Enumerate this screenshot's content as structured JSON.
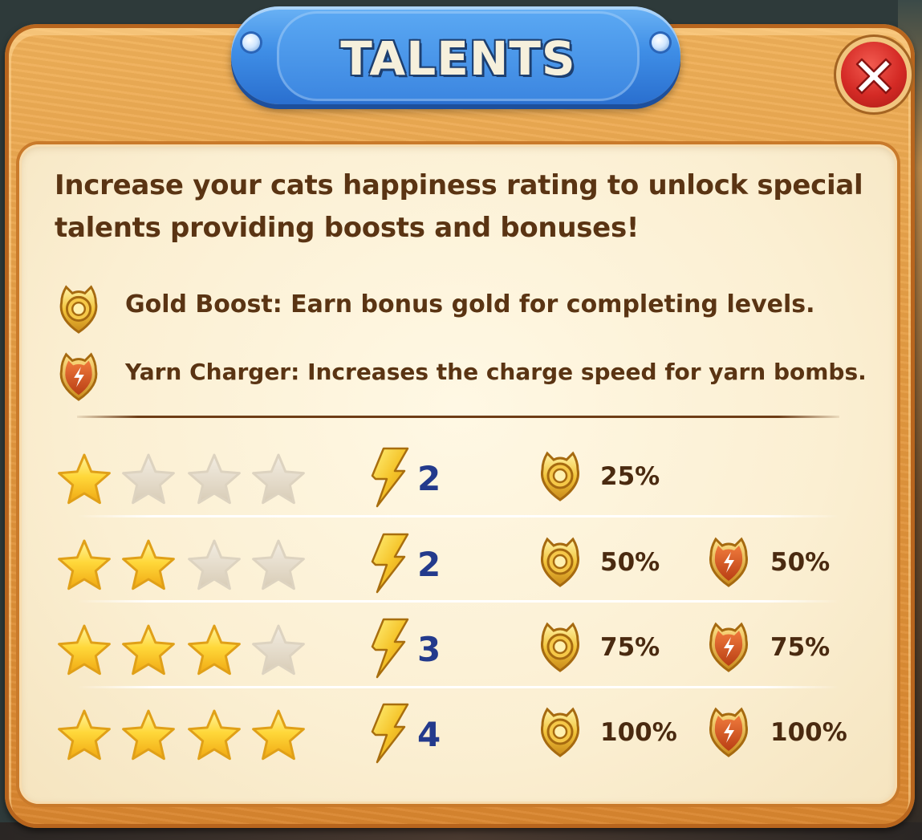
{
  "window": {
    "title": "TALENTS"
  },
  "close_button": {
    "icon": "close-icon"
  },
  "intro": "Increase your cats happiness rating to unlock special talents providing boosts and bonuses!",
  "legend": [
    {
      "icon": "gold-boost-icon",
      "text": "Gold Boost: Earn bonus gold for completing levels."
    },
    {
      "icon": "yarn-charger-icon",
      "text": "Yarn Charger: Increases the charge speed for yarn bombs."
    }
  ],
  "tiers": [
    {
      "stars_filled": 1,
      "stars_total": 4,
      "charge": "2",
      "gold_boost": "25%",
      "yarn_charger": ""
    },
    {
      "stars_filled": 2,
      "stars_total": 4,
      "charge": "2",
      "gold_boost": "50%",
      "yarn_charger": "50%"
    },
    {
      "stars_filled": 3,
      "stars_total": 4,
      "charge": "3",
      "gold_boost": "75%",
      "yarn_charger": "75%"
    },
    {
      "stars_filled": 4,
      "stars_total": 4,
      "charge": "4",
      "gold_boost": "100%",
      "yarn_charger": "100%"
    }
  ],
  "colors": {
    "frame_wood": "#e49a40",
    "panel_cream": "#fbefd2",
    "title_blue": "#3f8ee6",
    "close_red": "#d42a25",
    "star_gold": "#ffd83a",
    "star_empty": "#e6dccb",
    "charge_blue": "#233a8c",
    "text_brown": "#5a3413"
  }
}
